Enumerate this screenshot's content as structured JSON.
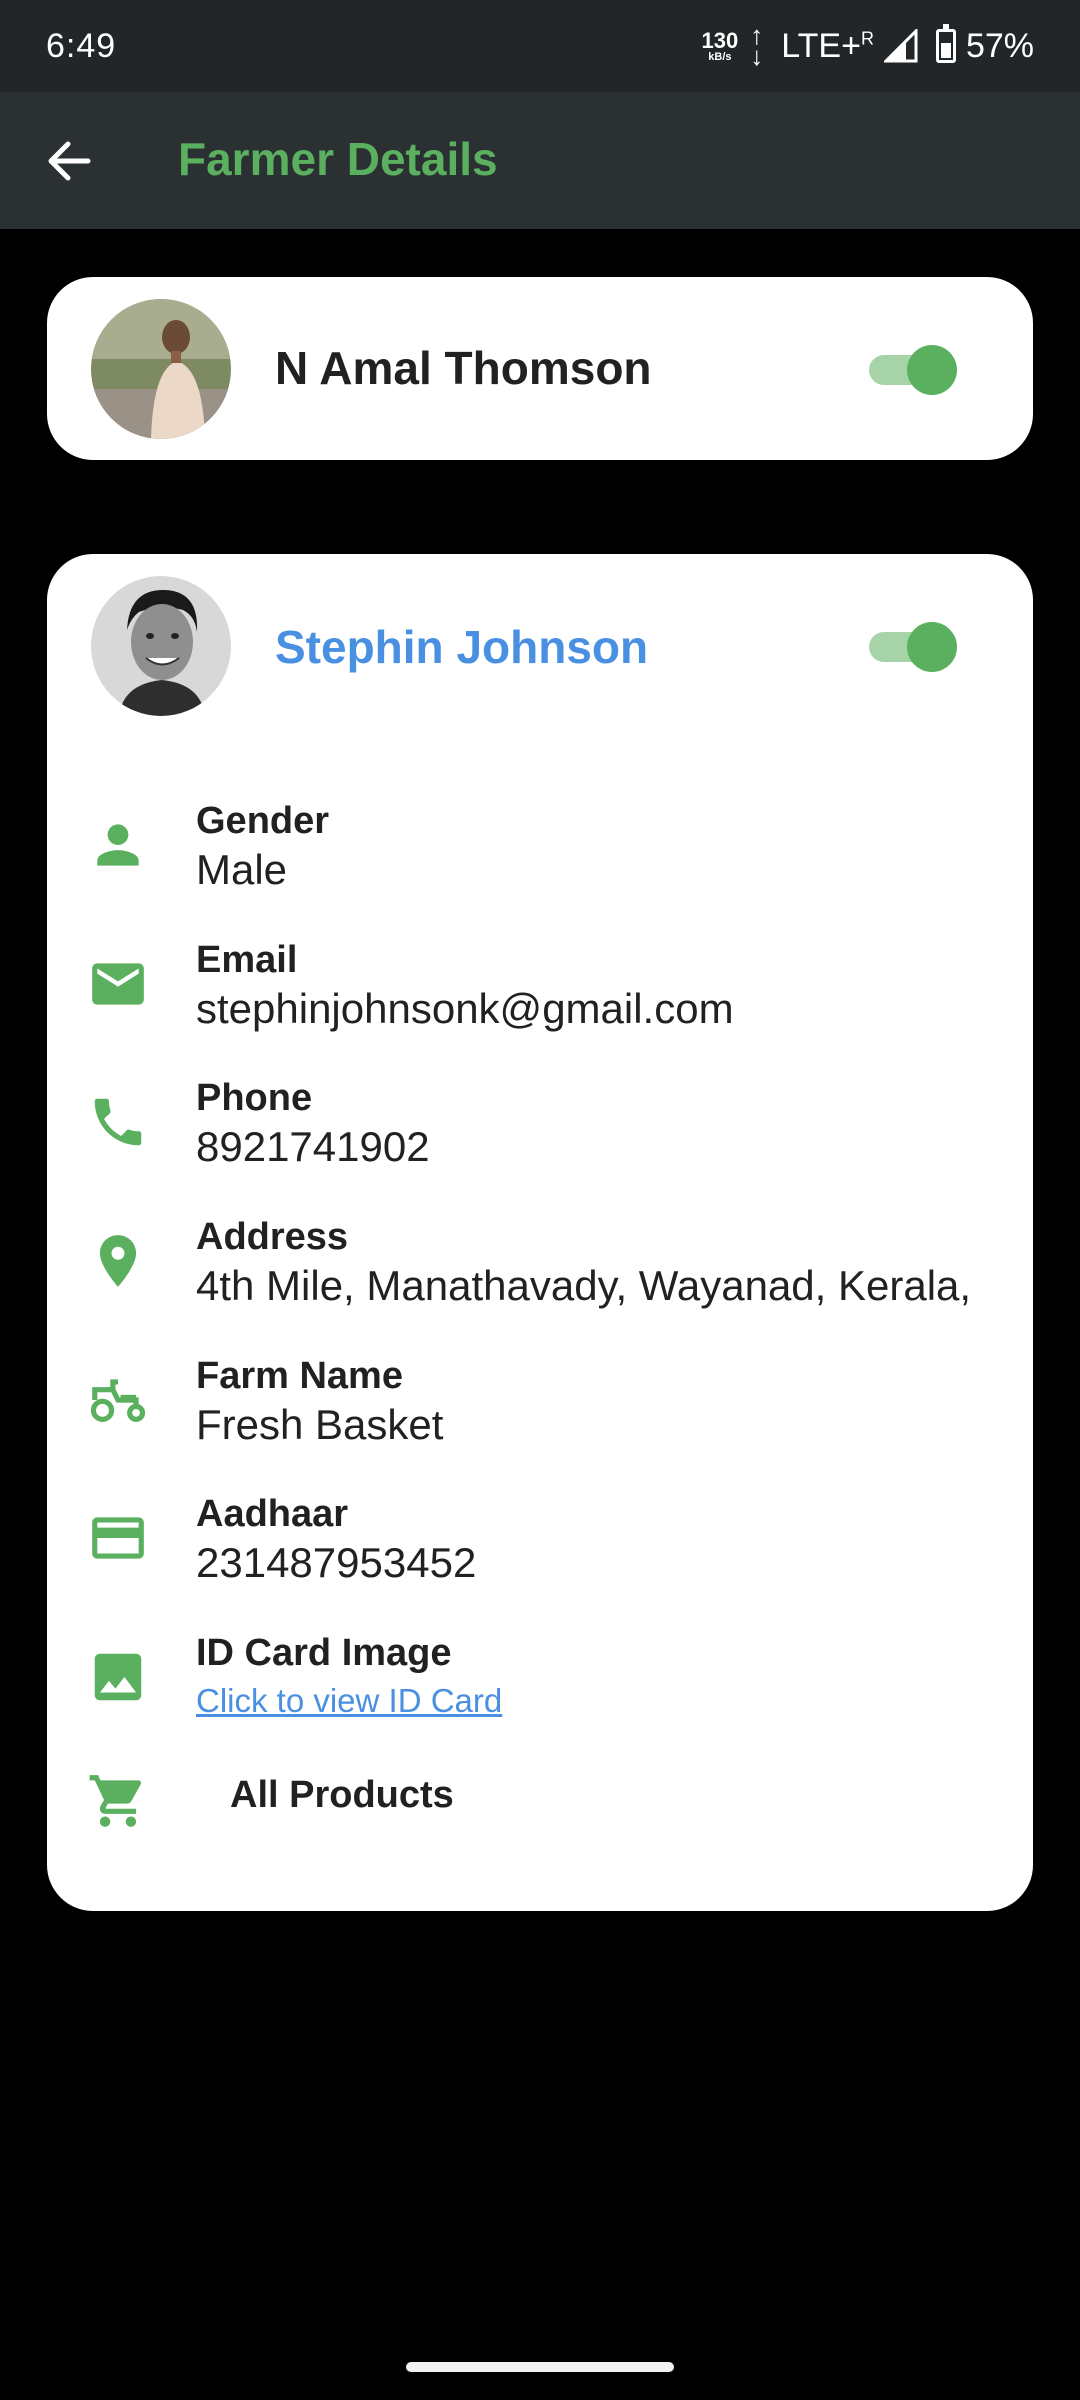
{
  "status_bar": {
    "time": "6:49",
    "net_speed_value": "130",
    "net_speed_unit": "kB/s",
    "network": "LTE+",
    "roaming": "R",
    "battery": "57%"
  },
  "app_bar": {
    "title": "Farmer Details"
  },
  "farmers": [
    {
      "name": "N Amal Thomson",
      "toggle_on": true
    },
    {
      "name": "Stephin Johnson",
      "toggle_on": true,
      "details": {
        "gender_label": "Gender",
        "gender_value": "Male",
        "email_label": "Email",
        "email_value": "stephinjohnsonk@gmail.com",
        "phone_label": "Phone",
        "phone_value": "8921741902",
        "address_label": "Address",
        "address_value": "4th Mile, Manathavady, Wayanad, Kerala,",
        "farm_label": "Farm Name",
        "farm_value": "Fresh Basket",
        "aadhaar_label": "Aadhaar",
        "aadhaar_value": "231487953452",
        "idcard_label": "ID Card Image",
        "idcard_link": "Click to view ID Card",
        "products_label": "All Products"
      }
    }
  ],
  "colors": {
    "accent_green": "#5ab05e",
    "link_blue": "#4a90e2",
    "app_bar_bg": "#2b3033"
  }
}
